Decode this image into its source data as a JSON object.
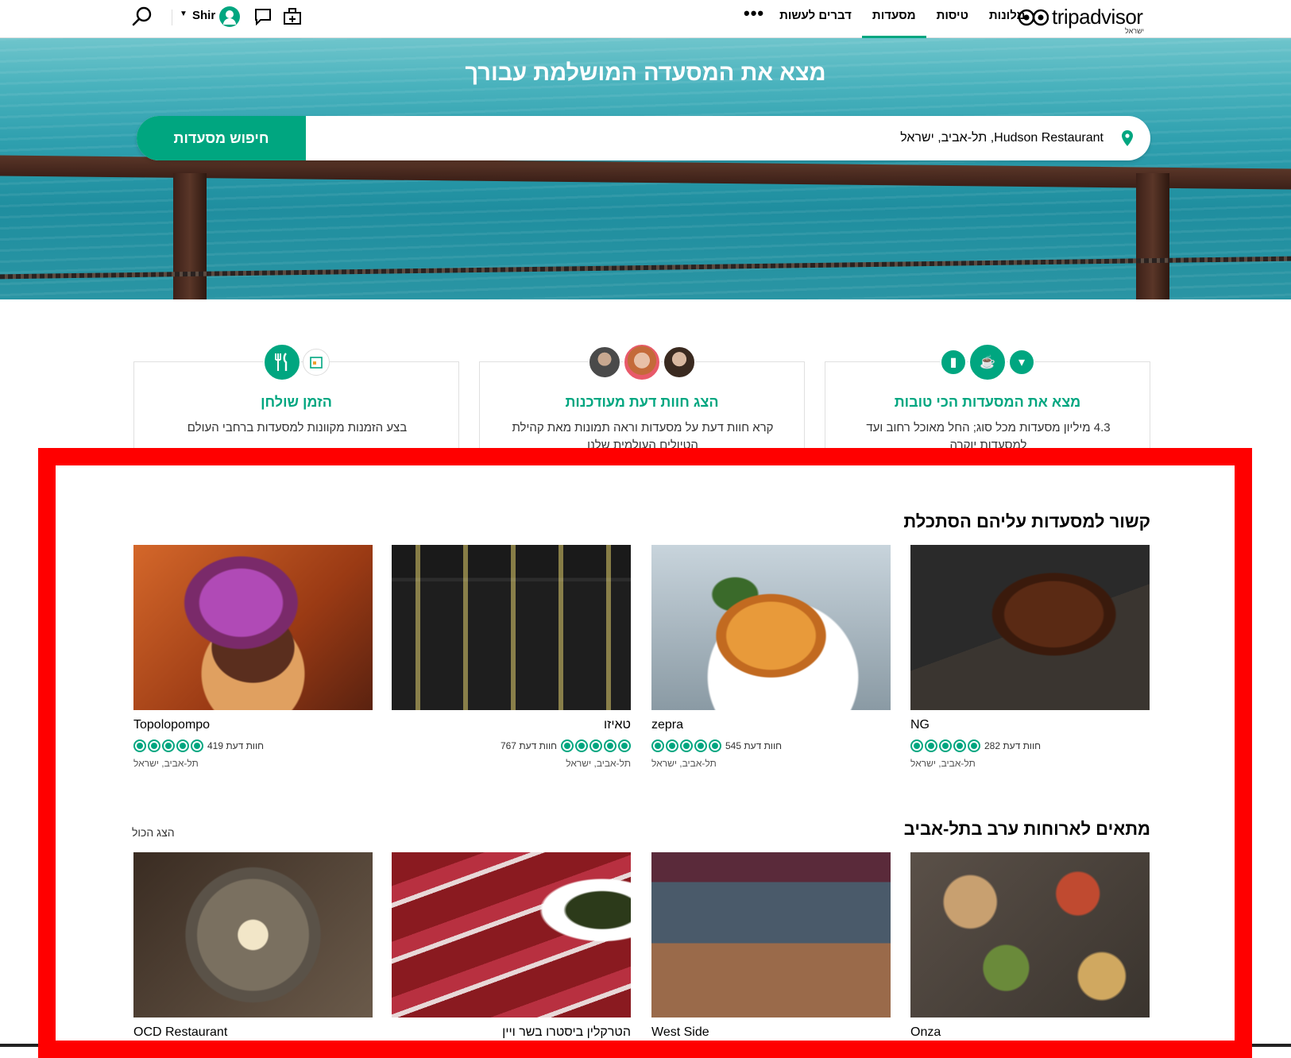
{
  "brand": {
    "logo_trip": "trip",
    "logo_advisor": "advisor",
    "logo_sub": "ישראל",
    "accent": "#00a680"
  },
  "nav": {
    "items": [
      {
        "label": "מלונות",
        "active": false
      },
      {
        "label": "טיסות",
        "active": false
      },
      {
        "label": "מסעדות",
        "active": true
      },
      {
        "label": "דברים לעשות",
        "active": false
      }
    ],
    "more": "•••",
    "user_name": "Shir",
    "icons": [
      "search-icon",
      "caret-down-icon",
      "user-avatar",
      "message-icon",
      "trips-icon"
    ]
  },
  "hero": {
    "title": "מצא את המסעדה המושלמת עבורך",
    "search_value": "Hudson Restaurant, תל-אביב, ישראל",
    "search_button": "חיפוש מסעדות"
  },
  "features": [
    {
      "title": "מצא את המסעדות הכי טובות",
      "desc": "4.3 מיליון מסעדות מכל סוג; החל מאוכל רחוב ועד למסעדות יוקרה"
    },
    {
      "title": "הצג חוות דעת מעודכנות",
      "desc": "קרא חוות דעת על מסעדות וראה תמונות  מאת קהילת הטיולים העולמית שלנו"
    },
    {
      "title": "הזמן שולחן",
      "desc": "בצע הזמנות מקוונות למסעדות ברחבי העולם"
    }
  ],
  "section_recent": {
    "title": "קשור למסעדות עליהם הסתכלת",
    "cards": [
      {
        "name": "NG",
        "reviews": "282 חוות דעת",
        "location": "תל-אביב, ישראל",
        "rating": 4.5
      },
      {
        "name": "zepra",
        "reviews": "545 חוות דעת",
        "location": "תל-אביב, ישראל",
        "rating": 4.5
      },
      {
        "name": "טאיזו",
        "reviews": "767 חוות דעת",
        "location": "תל-אביב, ישראל",
        "rating": 4.5
      },
      {
        "name": "Topolopompo",
        "reviews": "419 חוות דעת",
        "location": "תל-אביב, ישראל",
        "rating": 4.5
      }
    ]
  },
  "section_dinner": {
    "title": "מתאים לארוחות ערב בתל-אביב",
    "show_all": "הצג הכול",
    "cards": [
      {
        "name": "Onza"
      },
      {
        "name": "West Side"
      },
      {
        "name": "הטרקלין ביסטרו בשר ויין"
      },
      {
        "name": "OCD Restaurant"
      }
    ]
  }
}
